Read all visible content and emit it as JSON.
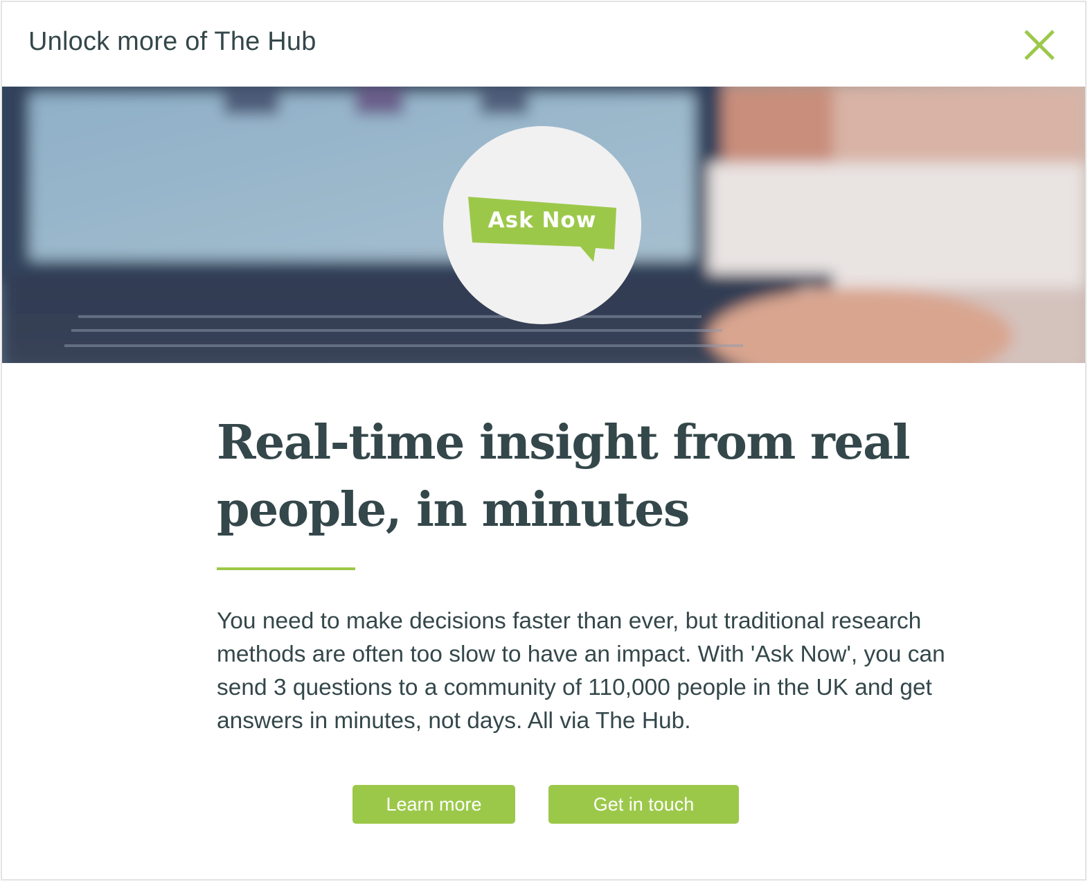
{
  "header": {
    "title": "Unlock more of The Hub",
    "close_icon": "close-icon"
  },
  "hero": {
    "badge_text": "Ask Now"
  },
  "content": {
    "headline": "Real-time insight from real people, in minutes",
    "body": "You need to make decisions faster than ever, but traditional research methods are often too slow to have an impact. With 'Ask Now', you can send 3 questions to a community of 110,000 people in the UK and get answers in minutes, not days. All via The Hub."
  },
  "actions": {
    "learn_more": "Learn more",
    "get_in_touch": "Get in touch"
  },
  "colors": {
    "accent": "#9cc84a",
    "text": "#34474a",
    "badge_background": "#f1f1f1"
  }
}
